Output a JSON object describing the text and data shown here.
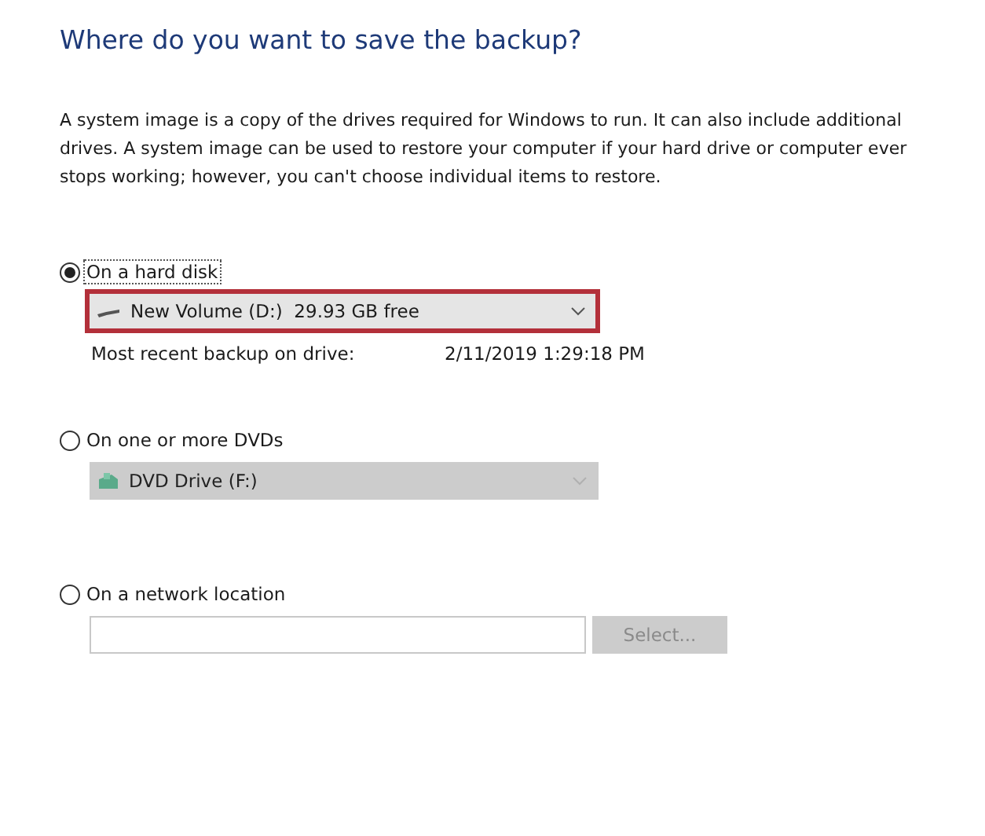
{
  "title": "Where do you want to save the backup?",
  "description": "A system image is a copy of the drives required for Windows to run. It can also include additional drives. A system image can be used to restore your computer if your hard drive or computer ever stops working; however, you can't choose individual items to restore.",
  "options": [
    {
      "kind": "drive",
      "label": "On a hard disk",
      "selected": true,
      "dropdown": {
        "value": "New Volume (D:)  29.93 GB free",
        "disabled": false,
        "highlighted": true
      },
      "info_label": "Most recent backup on drive:",
      "info_value": "2/11/2019 1:29:18 PM"
    },
    {
      "kind": "dvd",
      "label": "On one or more DVDs",
      "selected": false,
      "dropdown": {
        "value": "DVD Drive (F:)",
        "disabled": true,
        "highlighted": false
      }
    },
    {
      "kind": "network",
      "label": "On a network location",
      "selected": false,
      "button": {
        "label": "Select...",
        "disabled": true
      }
    }
  ]
}
